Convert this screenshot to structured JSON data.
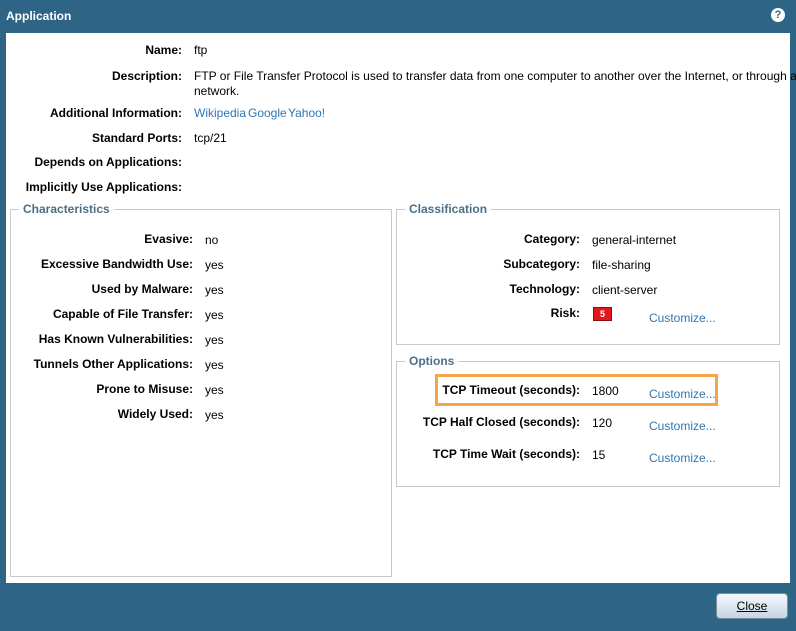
{
  "dialog": {
    "title": "Application"
  },
  "general": {
    "name_label": "Name:",
    "name_value": "ftp",
    "description_label": "Description:",
    "description_value_line1": "FTP or File Transfer Protocol is used to transfer data from one computer to another over the Internet, or through a",
    "description_value_line2": "network.",
    "additional_info_label": "Additional Information:",
    "additional_info_links": [
      "Wikipedia",
      "Google",
      "Yahoo!"
    ],
    "standard_ports_label": "Standard Ports:",
    "standard_ports_value": "tcp/21",
    "depends_on_label": "Depends on Applications:",
    "implicitly_use_label": "Implicitly Use Applications:"
  },
  "characteristics": {
    "title": "Characteristics",
    "items": [
      {
        "label": "Evasive:",
        "value": "no"
      },
      {
        "label": "Excessive Bandwidth Use:",
        "value": "yes"
      },
      {
        "label": "Used by Malware:",
        "value": "yes"
      },
      {
        "label": "Capable of File Transfer:",
        "value": "yes"
      },
      {
        "label": "Has Known Vulnerabilities:",
        "value": "yes"
      },
      {
        "label": "Tunnels Other Applications:",
        "value": "yes"
      },
      {
        "label": "Prone to Misuse:",
        "value": "yes"
      },
      {
        "label": "Widely Used:",
        "value": "yes"
      }
    ]
  },
  "classification": {
    "title": "Classification",
    "category_label": "Category:",
    "category_value": "general-internet",
    "subcategory_label": "Subcategory:",
    "subcategory_value": "file-sharing",
    "technology_label": "Technology:",
    "technology_value": "client-server",
    "risk_label": "Risk:",
    "risk_value": "5",
    "risk_color": "#e0191d",
    "customize_label": "Customize..."
  },
  "options": {
    "title": "Options",
    "items": [
      {
        "label": "TCP Timeout (seconds):",
        "value": "1800",
        "customize": "Customize..."
      },
      {
        "label": "TCP Half Closed (seconds):",
        "value": "120",
        "customize": "Customize..."
      },
      {
        "label": "TCP Time Wait (seconds):",
        "value": "15",
        "customize": "Customize..."
      }
    ]
  },
  "footer": {
    "close_label": "Close"
  },
  "colors": {
    "header_bg": "#2e6587",
    "link": "#2d76b5",
    "highlight": "#f5a54a"
  }
}
